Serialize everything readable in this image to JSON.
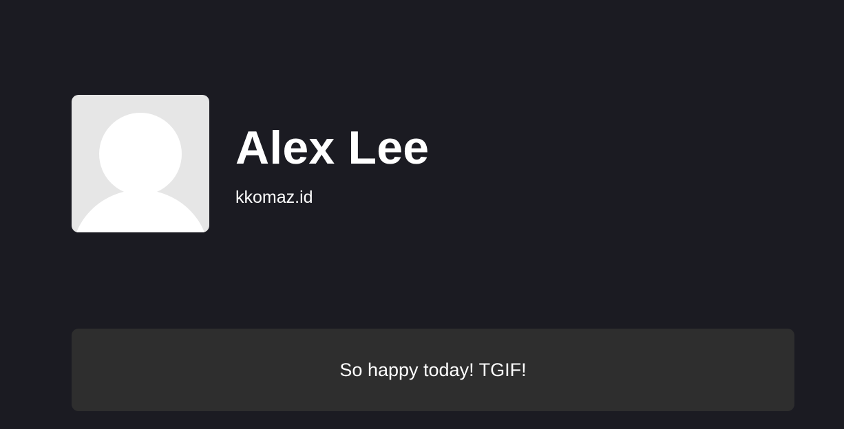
{
  "profile": {
    "avatar_icon": "default-user-avatar-icon",
    "name": "Alex Lee",
    "handle": "kkomaz.id"
  },
  "status": {
    "message": "So happy today! TGIF!"
  },
  "colors": {
    "background": "#1b1b22",
    "card": "#2e2e2e",
    "avatar_bg": "#e6e6e6",
    "text": "#ffffff"
  }
}
